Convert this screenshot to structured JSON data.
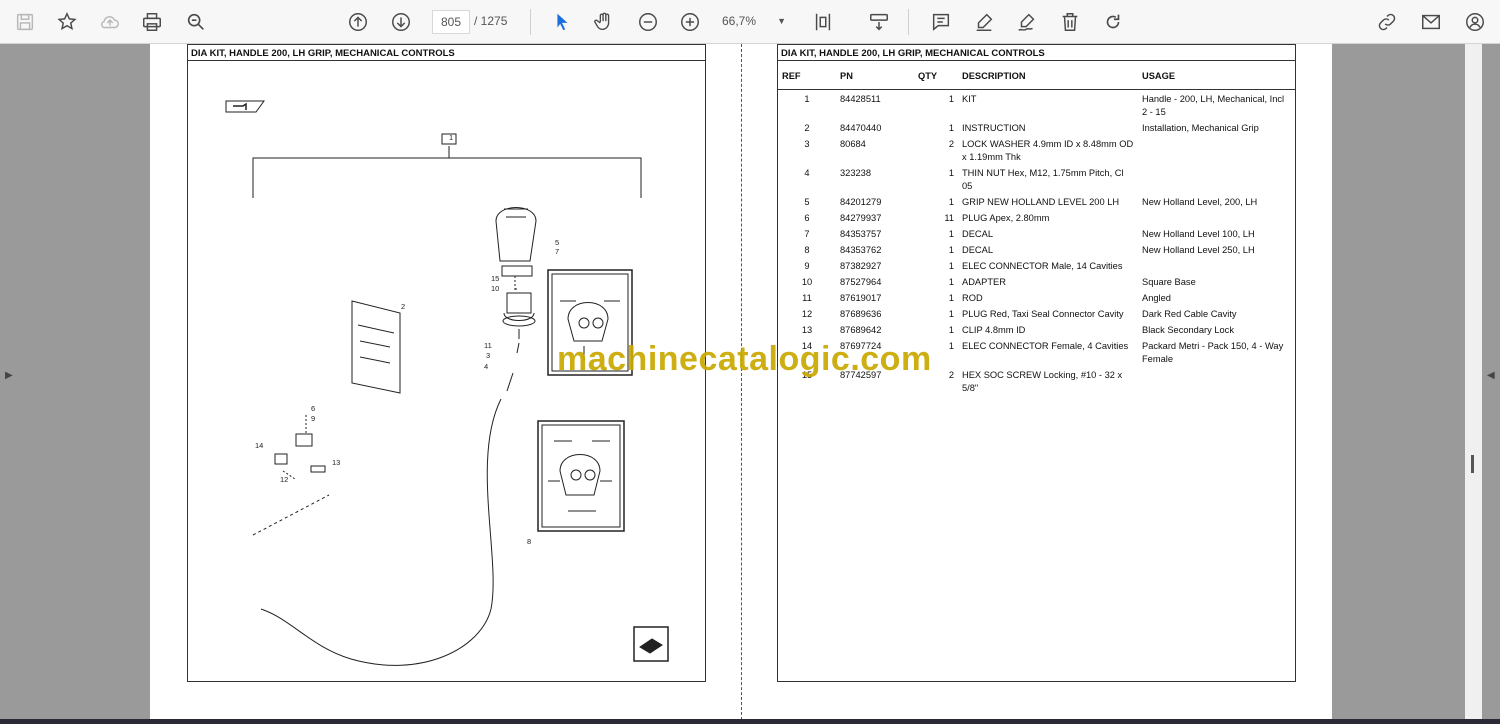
{
  "toolbar": {
    "page_current": "805",
    "page_total": "/ 1275",
    "zoom": "66,7%"
  },
  "left_page": {
    "title": "DIA KIT, HANDLE 200, LH GRIP, MECHANICAL CONTROLS",
    "callouts": [
      "1",
      "2",
      "5",
      "7",
      "15",
      "10",
      "11",
      "3",
      "4",
      "6",
      "9",
      "14",
      "13",
      "12",
      "8"
    ]
  },
  "right_page": {
    "title": "DIA KIT, HANDLE 200, LH GRIP, MECHANICAL CONTROLS",
    "headers": {
      "ref": "REF",
      "pn": "PN",
      "qty": "QTY",
      "desc": "DESCRIPTION",
      "usage": "USAGE"
    },
    "rows": [
      {
        "ref": "1",
        "pn": "84428511",
        "qty": "1",
        "desc": "KIT",
        "usage": "Handle - 200, LH, Mechanical, Incl 2 - 15"
      },
      {
        "ref": "2",
        "pn": "84470440",
        "qty": "1",
        "desc": "INSTRUCTION",
        "usage": "Installation, Mechanical Grip"
      },
      {
        "ref": "3",
        "pn": "80684",
        "qty": "2",
        "desc": "LOCK WASHER 4.9mm ID x 8.48mm OD x 1.19mm Thk",
        "usage": ""
      },
      {
        "ref": "4",
        "pn": "323238",
        "qty": "1",
        "desc": "THIN NUT Hex, M12, 1.75mm Pitch, Cl 05",
        "usage": ""
      },
      {
        "ref": "5",
        "pn": "84201279",
        "qty": "1",
        "desc": "GRIP NEW HOLLAND LEVEL 200 LH",
        "usage": "New Holland Level, 200, LH"
      },
      {
        "ref": "6",
        "pn": "84279937",
        "qty": "11",
        "desc": "PLUG Apex, 2.80mm",
        "usage": ""
      },
      {
        "ref": "7",
        "pn": "84353757",
        "qty": "1",
        "desc": "DECAL",
        "usage": "New Holland Level 100, LH"
      },
      {
        "ref": "8",
        "pn": "84353762",
        "qty": "1",
        "desc": "DECAL",
        "usage": "New Holland Level 250, LH"
      },
      {
        "ref": "9",
        "pn": "87382927",
        "qty": "1",
        "desc": "ELEC CONNECTOR Male, 14 Cavities",
        "usage": ""
      },
      {
        "ref": "10",
        "pn": "87527964",
        "qty": "1",
        "desc": "ADAPTER",
        "usage": "Square Base"
      },
      {
        "ref": "11",
        "pn": "87619017",
        "qty": "1",
        "desc": "ROD",
        "usage": "Angled"
      },
      {
        "ref": "12",
        "pn": "87689636",
        "qty": "1",
        "desc": "PLUG Red, Taxi Seal Connector Cavity",
        "usage": "Dark Red Cable Cavity"
      },
      {
        "ref": "13",
        "pn": "87689642",
        "qty": "1",
        "desc": "CLIP 4.8mm ID",
        "usage": "Black Secondary Lock"
      },
      {
        "ref": "14",
        "pn": "87697724",
        "qty": "1",
        "desc": "ELEC CONNECTOR Female, 4 Cavities",
        "usage": "Packard Metri - Pack 150, 4 - Way Female"
      },
      {
        "ref": "15",
        "pn": "87742597",
        "qty": "2",
        "desc": "HEX SOC SCREW Locking, #10 - 32 x 5/8\"",
        "usage": ""
      }
    ]
  },
  "watermark": "machinecatalogic.com"
}
